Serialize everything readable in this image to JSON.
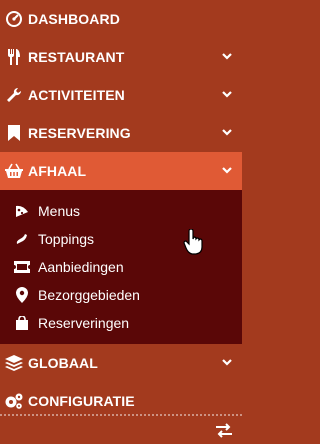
{
  "menu": {
    "dashboard": "DASHBOARD",
    "restaurant": "RESTAURANT",
    "activiteiten": "ACTIVITEITEN",
    "reservering": "RESERVERING",
    "afhaal": "AFHAAL",
    "globaal": "GLOBAAL",
    "configuratie": "CONFIGURATIE"
  },
  "submenu": {
    "menus": "Menus",
    "toppings": "Toppings",
    "aanbiedingen": "Aanbiedingen",
    "bezorggebieden": "Bezorggebieden",
    "reserveringen": "Reserveringen"
  },
  "colors": {
    "background": "#a33a1e",
    "active": "#e05a35",
    "submenu_bg": "#5a0707"
  },
  "icons": {
    "dashboard": "gauge-icon",
    "restaurant": "utensils-icon",
    "activiteiten": "wrench-icon",
    "reservering": "bookmark-icon",
    "afhaal": "basket-icon",
    "globaal": "layers-icon",
    "configuratie": "cogs-icon",
    "toggle": "exchange-arrows-icon"
  }
}
